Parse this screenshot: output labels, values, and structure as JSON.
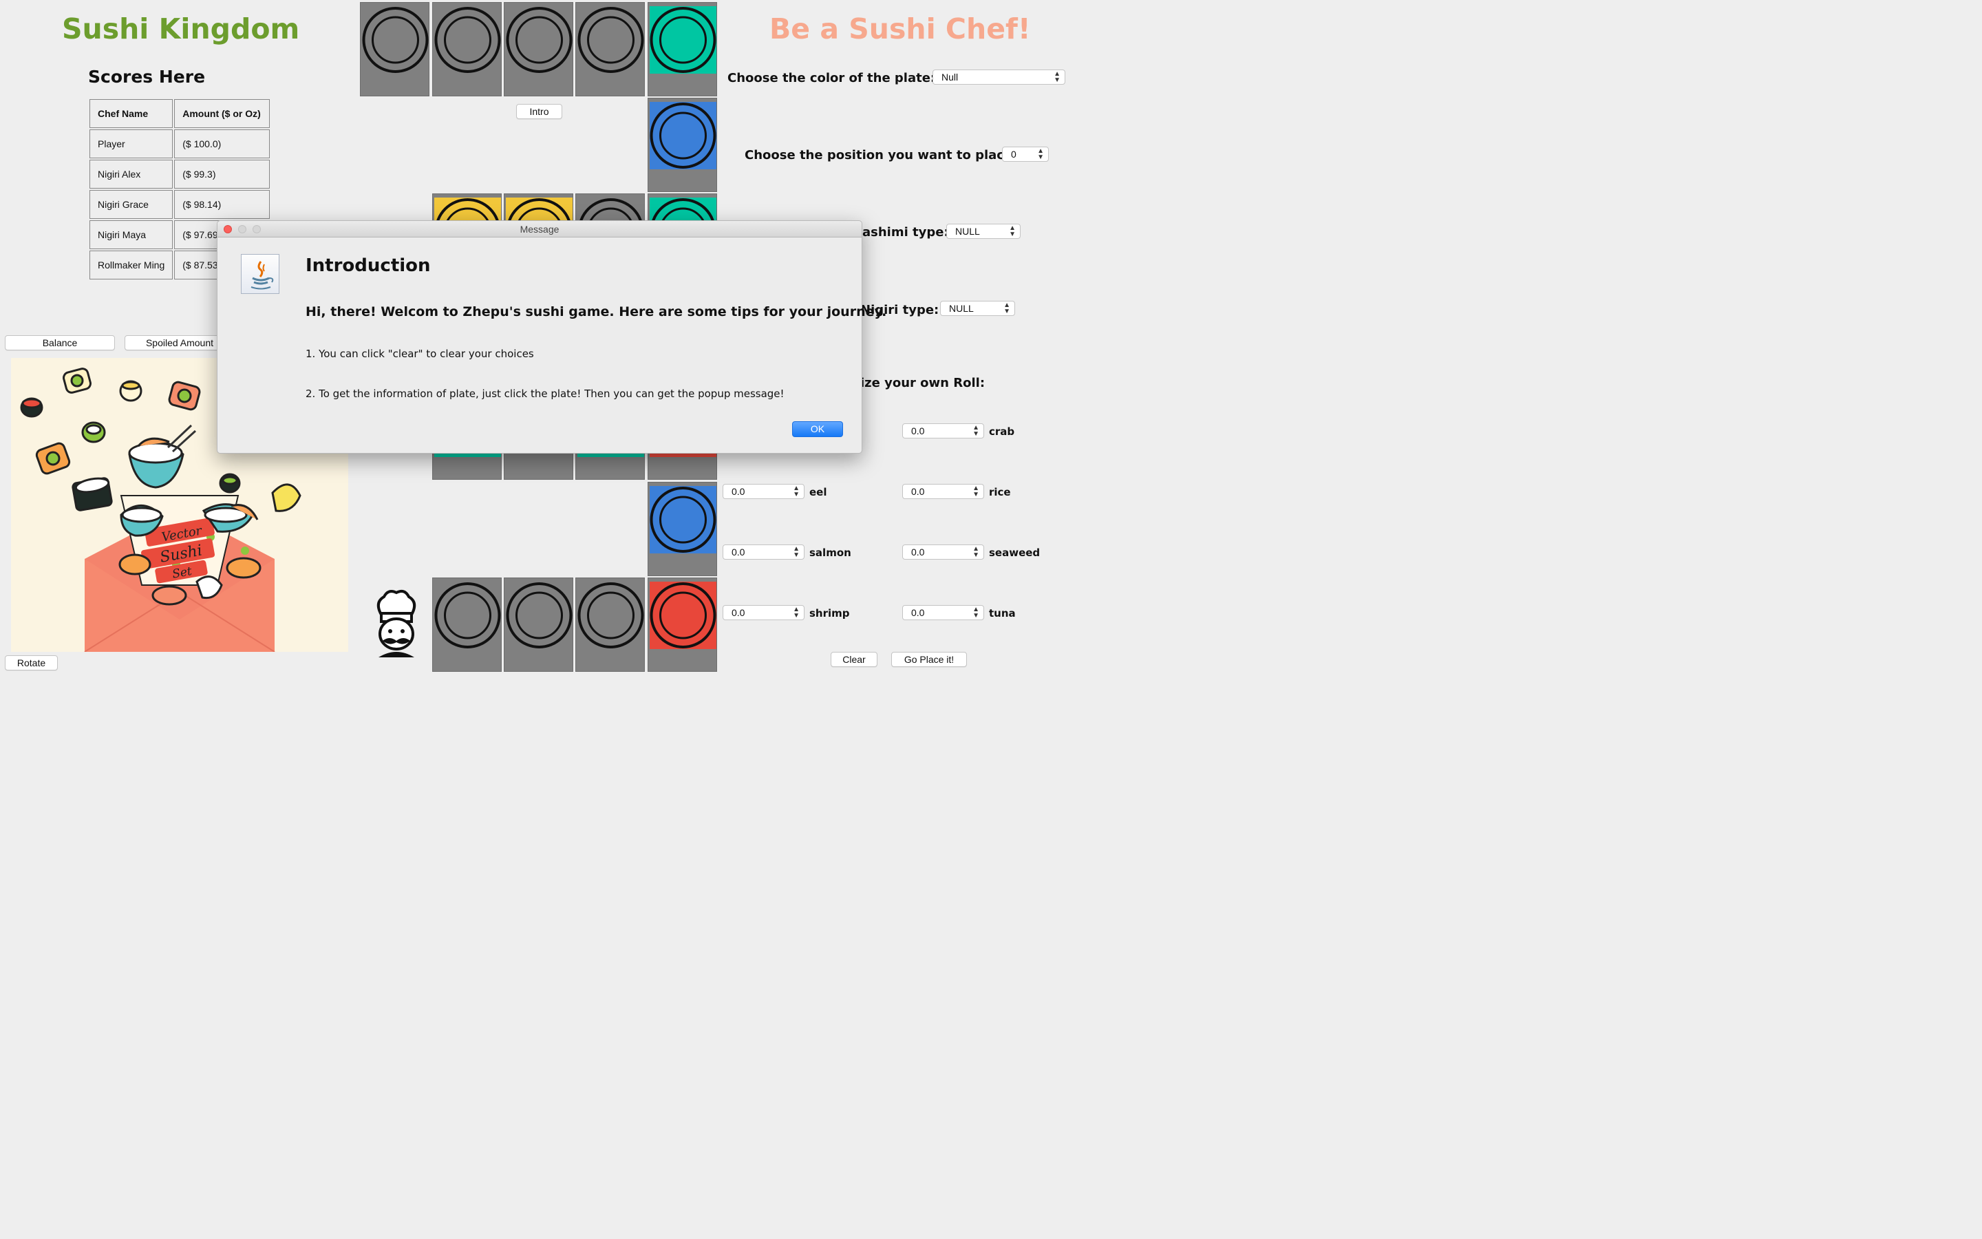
{
  "left": {
    "title": "Sushi Kingdom",
    "scores_title": "Scores Here",
    "table": {
      "headers": [
        "Chef Name",
        "Amount ($ or Oz)"
      ],
      "rows": [
        [
          "Player",
          "($ 100.0)"
        ],
        [
          "Nigiri Alex",
          "($ 99.3)"
        ],
        [
          "Nigiri Grace",
          "($ 98.14)"
        ],
        [
          "Nigiri Maya",
          "($ 97.69"
        ],
        [
          "Rollmaker Ming",
          "($ 87.53"
        ]
      ]
    },
    "balance_button": "Balance",
    "spoiled_button": "Spoiled Amount",
    "rotate_button": "Rotate",
    "image_text": {
      "line1": "Vector",
      "line2": "Sushi",
      "line3": "Set"
    }
  },
  "center": {
    "intro_button": "Intro",
    "plate_colors": {
      "gray": "#808080",
      "green": "#00c6a2",
      "blue": "#3b7fd8",
      "yellow": "#f2c73a",
      "red": "#e8473a"
    }
  },
  "right": {
    "title": "Be a Sushi Chef!",
    "plate_color_label": "Choose the color of the plate:",
    "plate_color_value": "Null",
    "position_label": "Choose the position you want to place:",
    "position_value": "0",
    "sashimi_label": "ashimi type:",
    "sashimi_value": "NULL",
    "nigiri_label": "Nigiri type:",
    "nigiri_value": "NULL",
    "roll_label": "ize your own Roll:",
    "ingredients": [
      {
        "name": "crab",
        "value": "0.0"
      },
      {
        "name": "eel",
        "value": "0.0"
      },
      {
        "name": "rice",
        "value": "0.0"
      },
      {
        "name": "salmon",
        "value": "0.0"
      },
      {
        "name": "seaweed",
        "value": "0.0"
      },
      {
        "name": "shrimp",
        "value": "0.0"
      },
      {
        "name": "tuna",
        "value": "0.0"
      }
    ],
    "clear_button": "Clear",
    "place_button": "Go Place it!"
  },
  "dialog": {
    "window_title": "Message",
    "heading": "Introduction",
    "greeting": "Hi, there! Welcom to Zhepu's sushi game. Here are some tips for your journey.",
    "tip1": "1. You can click \"clear\" to clear your choices",
    "tip2": "2. To get the information of plate, just click the plate! Then you can get the popup message!",
    "ok_button": "OK",
    "icon": "java-coffee-cup-icon"
  }
}
